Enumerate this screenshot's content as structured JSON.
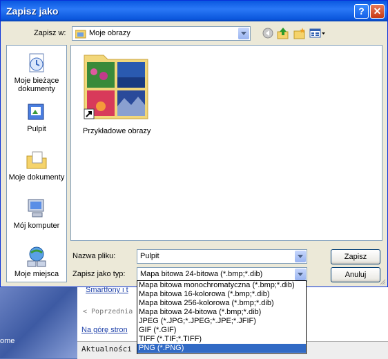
{
  "window": {
    "title": "Zapisz jako",
    "help_label": "?",
    "close_label": "✕"
  },
  "location": {
    "label": "Zapisz w:",
    "value": "Moje obrazy"
  },
  "toolbar": {
    "icons": [
      "back-icon",
      "up-folder-icon",
      "new-folder-icon",
      "views-menu-icon"
    ]
  },
  "places": [
    {
      "label": "Moje bieżące dokumenty"
    },
    {
      "label": "Pulpit"
    },
    {
      "label": "Moje dokumenty"
    },
    {
      "label": "Mój komputer"
    },
    {
      "label": "Moje miejsca"
    }
  ],
  "files": [
    {
      "label": "Przykładowe obrazy"
    }
  ],
  "filename": {
    "label": "Nazwa pliku:",
    "value": "Pulpit"
  },
  "filetype": {
    "label": "Zapisz jako typ:",
    "value": "Mapa bitowa 24-bitowa (*.bmp;*.dib)",
    "options": [
      "Mapa bitowa monochromatyczna (*.bmp;*.dib)",
      "Mapa bitowa 16-kolorowa  (*.bmp;*.dib)",
      "Mapa bitowa 256-kolorowa (*.bmp;*.dib)",
      "Mapa bitowa 24-bitowa (*.bmp;*.dib)",
      "JPEG (*.JPG;*.JPEG;*.JPE;*.JFIF)",
      "GIF (*.GIF)",
      "TIFF (*.TIF;*.TIFF)",
      "PNG (*.PNG)"
    ],
    "selected_option": "PNG (*.PNG)"
  },
  "buttons": {
    "save": "Zapisz",
    "cancel": "Anuluj"
  },
  "background_page": {
    "link1": "Smartfony i t",
    "prev": "< Poprzednia",
    "top_link": "Na górę stron",
    "footer": "Aktualności |",
    "left_text": "ome"
  },
  "colors": {
    "title_bar": "#0a58e0",
    "selection": "#316ac5",
    "dialog_bg": "#ece9d8"
  }
}
